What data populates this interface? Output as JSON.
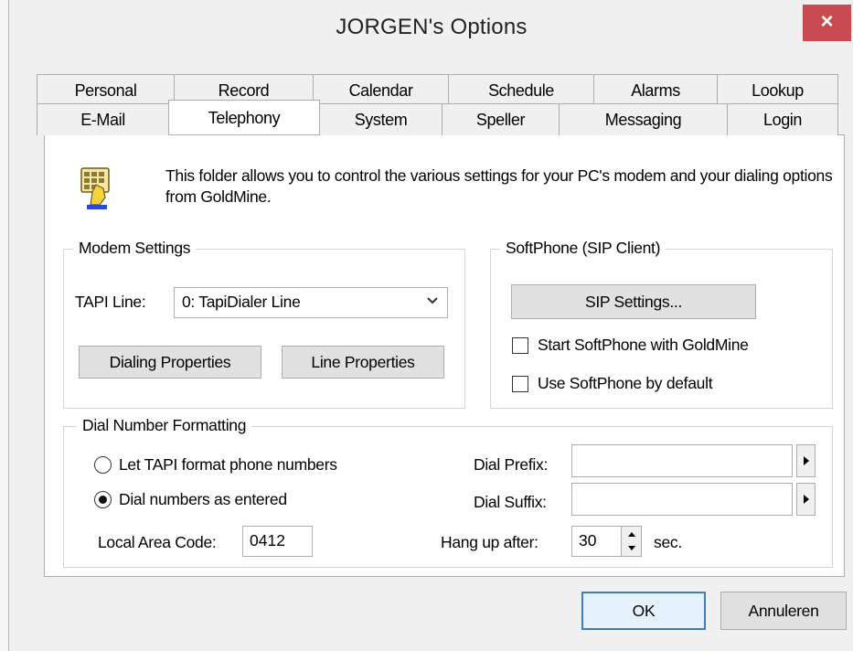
{
  "window": {
    "title": "JORGEN's Options",
    "close_label": "×"
  },
  "tabs": {
    "row1": [
      "Personal",
      "Record",
      "Calendar",
      "Schedule",
      "Alarms",
      "Lookup"
    ],
    "row2": [
      "E-Mail",
      "Telephony",
      "System",
      "Speller",
      "Messaging",
      "Login"
    ],
    "selected": "Telephony"
  },
  "intro": {
    "text": "This folder allows you to control the various settings for your PC's modem and your dialing options from GoldMine.",
    "icon": "phone-keypad-icon"
  },
  "modem": {
    "legend": "Modem Settings",
    "tapi_label": "TAPI Line:",
    "tapi_value": "0: TapiDialer Line",
    "dialing_properties": "Dialing Properties",
    "line_properties": "Line Properties"
  },
  "softphone": {
    "legend": "SoftPhone (SIP Client)",
    "sip_settings": "SIP Settings...",
    "start_with_goldmine": "Start SoftPhone with GoldMine",
    "start_with_goldmine_checked": false,
    "use_by_default": "Use SoftPhone by default",
    "use_by_default_checked": false
  },
  "dial_format": {
    "legend": "Dial Number Formatting",
    "option_tapi": "Let TAPI format phone numbers",
    "option_entered": "Dial numbers as entered",
    "selected": "Dial numbers as entered",
    "local_area_code_label": "Local Area Code:",
    "local_area_code": "0412",
    "dial_prefix_label": "Dial Prefix:",
    "dial_prefix": "",
    "dial_suffix_label": "Dial Suffix:",
    "dial_suffix": "",
    "hang_up_label": "Hang up after:",
    "hang_up_value": "30",
    "hang_up_unit": "sec."
  },
  "buttons": {
    "ok": "OK",
    "cancel": "Annuleren"
  },
  "colors": {
    "close_button": "#c74b50",
    "default_button_border": "#3c7fb1"
  }
}
